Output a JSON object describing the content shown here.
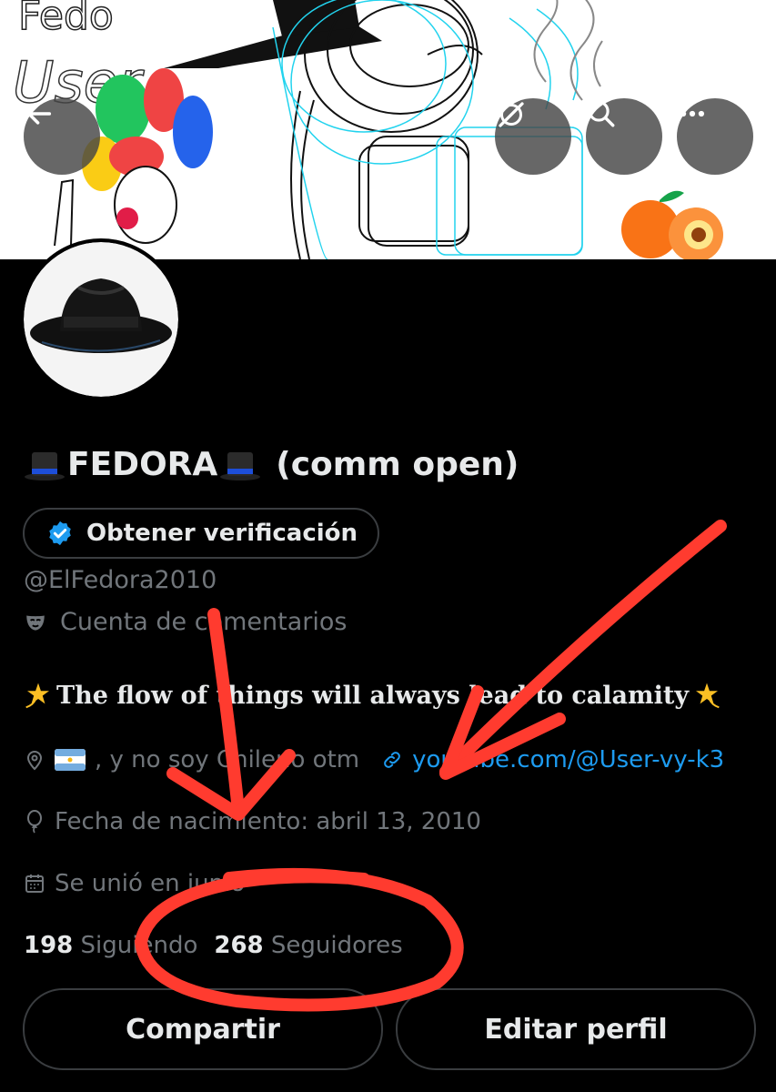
{
  "profile": {
    "display_name": "FEDORA",
    "name_suffix": "(comm open)",
    "handle": "@ElFedora2010",
    "category": "Cuenta de comentarios",
    "bio": "The flow of things will always lead to calamity",
    "location": ", y no soy Chileno otm",
    "website": "youtube.com/@User-vy-k3",
    "birthday": "Fecha de nacimiento: abril 13, 2010",
    "joined": "Se unió en junio"
  },
  "banner": {
    "doodle_text_1": "Fedo",
    "doodle_text_2": "User"
  },
  "actions": {
    "verify_label": "Obtener verificación",
    "share_label": "Compartir",
    "edit_label": "Editar perfil"
  },
  "stats": {
    "following_count": "198",
    "following_label": "Siguiendo",
    "followers_count": "268",
    "followers_label": "Seguidores"
  },
  "icons": [
    "back-arrow-icon",
    "grok-icon",
    "search-icon",
    "more-icon",
    "verified-badge-icon",
    "mask-icon",
    "location-icon",
    "argentina-flag-icon",
    "link-icon",
    "balloon-icon",
    "calendar-icon",
    "top-hat-emoji-icon",
    "dizzy-emoji-icon"
  ],
  "colors": {
    "accent": "#1d9bf0",
    "annotation": "#ff3b2f",
    "muted_text": "#71767b"
  }
}
